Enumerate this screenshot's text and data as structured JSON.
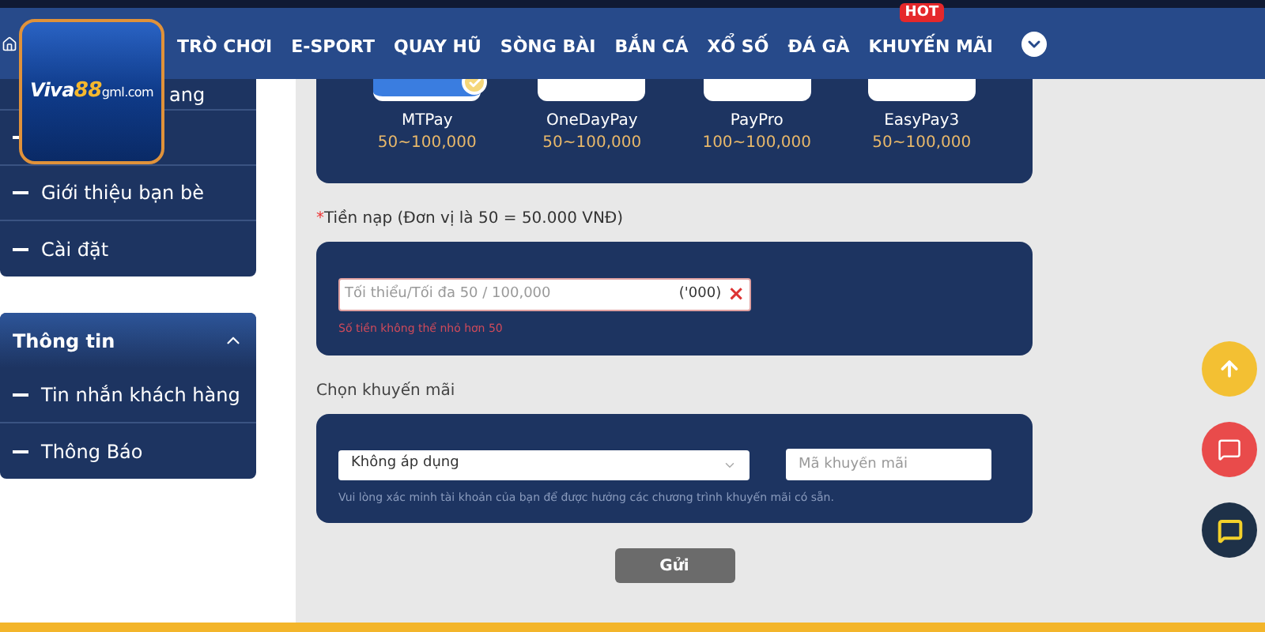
{
  "logo": {
    "brand": "Viva",
    "number": "88",
    "domain": "gml.com"
  },
  "nav": {
    "items": [
      "TRÒ CHƠI",
      "E-SPORT",
      "QUAY HŨ",
      "SÒNG BÀI",
      "BẮN CÁ",
      "XỔ SỐ",
      "ĐÁ GÀ",
      "KHUYẾN MÃI"
    ],
    "badge": "HOT"
  },
  "sidebar": {
    "groups": [
      {
        "items": [
          "ang",
          "Giới thiệu bạn bè",
          "Cài đặt"
        ]
      },
      {
        "title": "Thông tin",
        "expanded": true,
        "items": [
          "Tin nhắn khách hàng",
          "Thông Báo"
        ]
      }
    ]
  },
  "payment_methods": [
    {
      "name": "MTPay",
      "range": "50~100,000",
      "selected": true
    },
    {
      "name": "OneDayPay",
      "range": "50~100,000",
      "selected": false
    },
    {
      "name": "PayPro",
      "range": "100~100,000",
      "selected": false
    },
    {
      "name": "EasyPay3",
      "range": "50~100,000",
      "selected": false
    }
  ],
  "amount": {
    "label_mark": "*",
    "label": "Tiền nạp  (Đơn vị là 50 = 50.000 VNĐ)",
    "placeholder": "Tối thiểu/Tối đa 50 / 100,000",
    "unit": "('000)",
    "clear": "×",
    "error": "Số tiền không thể nhỏ hơn 50"
  },
  "promotion": {
    "label": "Chọn khuyến mãi",
    "select_value": "Không áp dụng",
    "code_placeholder": "Mã khuyến mãi",
    "note": "Vui lòng xác minh tài khoản của bạn để được hưởng các chương trình khuyến mãi có sẵn."
  },
  "submit": "Gửi"
}
